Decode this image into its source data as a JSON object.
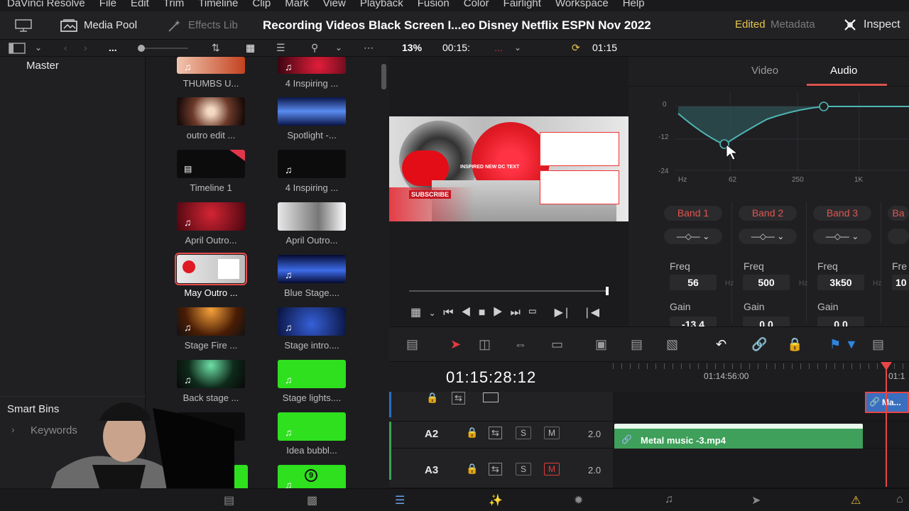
{
  "menu": [
    "DaVinci Resolve",
    "File",
    "Edit",
    "Trim",
    "Timeline",
    "Clip",
    "Mark",
    "View",
    "Playback",
    "Fusion",
    "Color",
    "Fairlight",
    "Workspace",
    "Help"
  ],
  "toolbar": {
    "media_pool": "Media Pool",
    "effects": "Effects Lib",
    "title": "Recording Videos Black Screen I...eo Disney Netflix ESPN Nov 2022",
    "edited": "Edited",
    "metadata": "Metadata",
    "inspector": "Inspect"
  },
  "subbar": {
    "ellipsis": "...",
    "zoom": "13%",
    "timecode": "00:15:",
    "viewer_tc": "01:15"
  },
  "bins": {
    "master": "Master",
    "smart_bins": "Smart Bins",
    "keywords": "Keywords"
  },
  "clips": [
    {
      "label": "THUMBS U...",
      "col": 0,
      "row": 0
    },
    {
      "label": "4 Inspiring ...",
      "col": 1,
      "row": 0
    },
    {
      "label": "outro edit ...",
      "col": 0,
      "row": 1
    },
    {
      "label": "Spotlight -...",
      "col": 1,
      "row": 1
    },
    {
      "label": "Timeline 1",
      "col": 0,
      "row": 2
    },
    {
      "label": "4 Inspiring ...",
      "col": 1,
      "row": 2
    },
    {
      "label": "April Outro...",
      "col": 0,
      "row": 3
    },
    {
      "label": "April Outro...",
      "col": 1,
      "row": 3
    },
    {
      "label": "May Outro ...",
      "col": 0,
      "row": 4
    },
    {
      "label": "Blue Stage....",
      "col": 1,
      "row": 4
    },
    {
      "label": "Stage Fire ...",
      "col": 0,
      "row": 5
    },
    {
      "label": "Stage intro....",
      "col": 1,
      "row": 5
    },
    {
      "label": "Back stage ...",
      "col": 0,
      "row": 6
    },
    {
      "label": "Stage lights....",
      "col": 1,
      "row": 6
    },
    {
      "label": "",
      "col": 0,
      "row": 7
    },
    {
      "label": "Idea bubbl...",
      "col": 1,
      "row": 7
    }
  ],
  "viewer": {
    "subscribe": "SUBSCRIBE",
    "overlay_text": "INSPIRED NEW DC TEXT"
  },
  "inspector": {
    "tab_video": "Video",
    "tab_audio": "Audio",
    "db_labels": [
      "0",
      "-12",
      "-24"
    ],
    "freq_labels": [
      "Hz",
      "62",
      "250",
      "1K"
    ],
    "bands": [
      {
        "name": "Band 1",
        "freq": "56",
        "gain": "-13.4"
      },
      {
        "name": "Band 2",
        "freq": "500",
        "gain": "0.0"
      },
      {
        "name": "Band 3",
        "freq": "3k50",
        "gain": "0.0"
      },
      {
        "name": "Ba",
        "freq": "10",
        "gain": ""
      }
    ],
    "freq_label": "Freq",
    "gain_label": "Gain",
    "hz_unit": "Hz",
    "fre_trunc": "Fre"
  },
  "timeline": {
    "timecode": "01:15:28:12",
    "ruler_a": "01:14:56:00",
    "ruler_b": "01:1",
    "tracks": [
      {
        "name": "A2",
        "volume": "2.0"
      },
      {
        "name": "A3",
        "volume": "2.0"
      }
    ],
    "s_label": "S",
    "m_label": "M",
    "audio_clip": "Metal music -3.mp4",
    "video_clip": "Ma..."
  }
}
